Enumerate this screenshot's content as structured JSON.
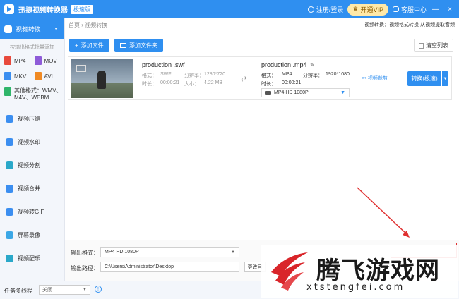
{
  "app": {
    "title": "迅捷视频转换器",
    "badge": "极速版"
  },
  "titlebar": {
    "login": "注册/登录",
    "vip": "开通VIP",
    "service": "客服中心",
    "minimize": "—",
    "close": "×"
  },
  "sidebar": {
    "active": "视频转换",
    "sub_heading": "按输出格式批量添加",
    "formats": [
      "MP4",
      "MOV",
      "MKV",
      "AVI"
    ],
    "other_formats": "其他格式：WMV、M4V、WEBM...",
    "items": [
      "视频压缩",
      "视频水印",
      "视频分割",
      "视频合并",
      "视频转GIF",
      "屏幕录像",
      "视频配乐"
    ]
  },
  "main": {
    "breadcrumb": "首页 › 视频转换",
    "description": "视频转换：视频格式转换 从视频提取音频",
    "add_file": "添加文件",
    "add_folder": "添加文件夹",
    "clear_list": "清空列表"
  },
  "file": {
    "source_name": "production .swf",
    "format_label": "格式：",
    "source_format": "SWF",
    "resolution_label": "分辨率：",
    "source_resolution": "1280*720",
    "duration_label": "时长：",
    "source_duration": "00:00:21",
    "size_label": "大小：",
    "source_size": "4.22 MB",
    "target_name": "production .mp4",
    "target_format": "MP4",
    "target_resolution": "1920*1080",
    "target_duration": "00:00:21",
    "preset": "MP4   HD 1080P",
    "edit": "视频裁剪",
    "convert": "转换(极速)"
  },
  "bottom": {
    "output_format_label": "输出格式：",
    "output_format": "MP4   HD 1080P",
    "output_path_label": "输出路径：",
    "output_path": "C:\\Users\\Administrator\\Desktop",
    "change": "更改目"
  },
  "status": {
    "multithread_label": "任务多线程",
    "multithread_value": "关闭"
  },
  "watermark": {
    "title": "腾飞游戏网",
    "url": "xtstengfei.com"
  },
  "colors": {
    "accent": "#2f8ff0",
    "annotation": "#e03030"
  }
}
